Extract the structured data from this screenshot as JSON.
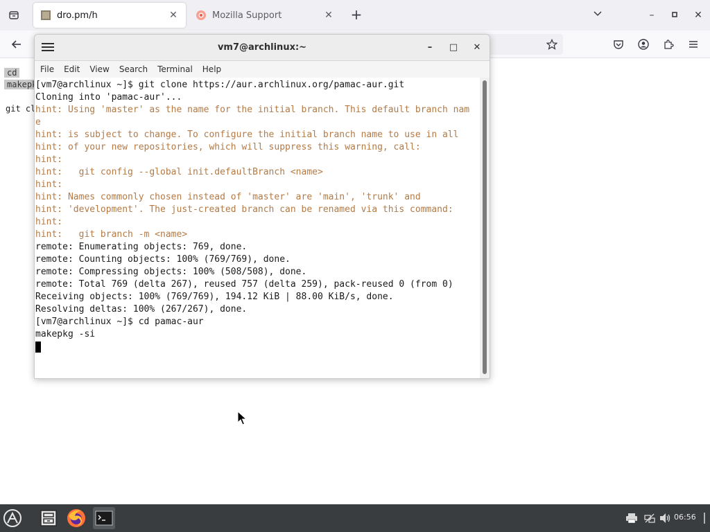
{
  "browser": {
    "tabs": [
      {
        "title": "dro.pm/h",
        "close": "✕"
      },
      {
        "title": "Mozilla Support",
        "close": "✕"
      }
    ],
    "new_tab": "+",
    "window_controls": {
      "list": "⌄",
      "minimize": "–",
      "maximize": "▫",
      "close": "✕"
    }
  },
  "page_snippets": [
    "cd",
    "makepk",
    "git cl"
  ],
  "terminal": {
    "title": "vm7@archlinux:~",
    "controls": {
      "minimize": "–",
      "maximize": "□",
      "close": "✕"
    },
    "menu": [
      "File",
      "Edit",
      "View",
      "Search",
      "Terminal",
      "Help"
    ],
    "lines": [
      {
        "text": "[vm7@archlinux ~]$ git clone https://aur.archlinux.org/pamac-aur.git",
        "hint": false
      },
      {
        "text": "Cloning into 'pamac-aur'...",
        "hint": false
      },
      {
        "text": "hint: Using 'master' as the name for the initial branch. This default branch nam",
        "hint": true
      },
      {
        "text": "e",
        "hint": true
      },
      {
        "text": "hint: is subject to change. To configure the initial branch name to use in all",
        "hint": true
      },
      {
        "text": "hint: of your new repositories, which will suppress this warning, call:",
        "hint": true
      },
      {
        "text": "hint:",
        "hint": true
      },
      {
        "text": "hint:   git config --global init.defaultBranch <name>",
        "hint": true
      },
      {
        "text": "hint:",
        "hint": true
      },
      {
        "text": "hint: Names commonly chosen instead of 'master' are 'main', 'trunk' and",
        "hint": true
      },
      {
        "text": "hint: 'development'. The just-created branch can be renamed via this command:",
        "hint": true
      },
      {
        "text": "hint:",
        "hint": true
      },
      {
        "text": "hint:   git branch -m <name>",
        "hint": true
      },
      {
        "text": "remote: Enumerating objects: 769, done.",
        "hint": false
      },
      {
        "text": "remote: Counting objects: 100% (769/769), done.",
        "hint": false
      },
      {
        "text": "remote: Compressing objects: 100% (508/508), done.",
        "hint": false
      },
      {
        "text": "remote: Total 769 (delta 267), reused 757 (delta 259), pack-reused 0 (from 0)",
        "hint": false
      },
      {
        "text": "Receiving objects: 100% (769/769), 194.12 KiB | 88.00 KiB/s, done.",
        "hint": false
      },
      {
        "text": "Resolving deltas: 100% (267/267), done.",
        "hint": false
      },
      {
        "text": "[vm7@archlinux ~]$ cd pamac-aur",
        "hint": false
      },
      {
        "text": "makepkg -si",
        "hint": false
      }
    ],
    "colors": {
      "hint": "#b47a45",
      "text": "#1a1a1a"
    }
  },
  "taskbar": {
    "clock": "06:56",
    "tray_icons": [
      "printer-icon",
      "network-icon",
      "volume-icon"
    ],
    "apps": [
      "file-manager-icon",
      "firefox-icon",
      "terminal-icon"
    ]
  }
}
